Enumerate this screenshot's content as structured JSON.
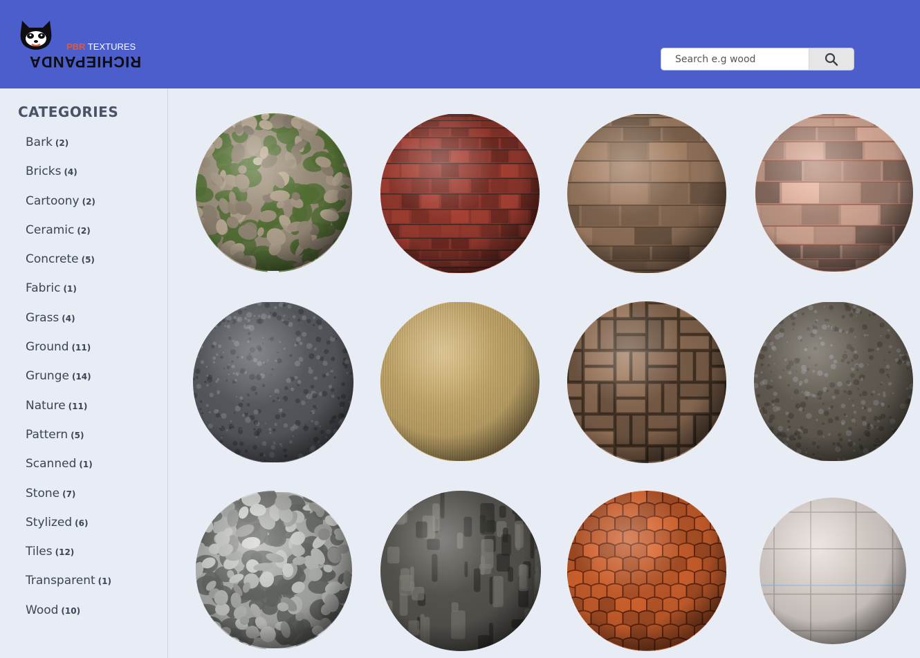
{
  "header": {
    "logo": {
      "pbr": "PBR",
      "textures": "TEXTURES",
      "brand": "RICHIEPANDA"
    },
    "search": {
      "placeholder": "Search e.g wood",
      "icon": "search-icon"
    },
    "background": "#4b5ecb"
  },
  "sidebar": {
    "title": "CATEGORIES",
    "categories": [
      {
        "label": "Bark",
        "count": "(2)"
      },
      {
        "label": "Bricks",
        "count": "(4)"
      },
      {
        "label": "Cartoony",
        "count": "(2)"
      },
      {
        "label": "Ceramic",
        "count": "(2)"
      },
      {
        "label": "Concrete",
        "count": "(5)"
      },
      {
        "label": "Fabric",
        "count": "(1)"
      },
      {
        "label": "Grass",
        "count": "(4)"
      },
      {
        "label": "Ground",
        "count": "(11)"
      },
      {
        "label": "Grunge",
        "count": "(14)"
      },
      {
        "label": "Nature",
        "count": "(11)"
      },
      {
        "label": "Pattern",
        "count": "(5)"
      },
      {
        "label": "Scanned",
        "count": "(1)"
      },
      {
        "label": "Stone",
        "count": "(7)"
      },
      {
        "label": "Stylized",
        "count": "(6)"
      },
      {
        "label": "Tiles",
        "count": "(12)"
      },
      {
        "label": "Transparent",
        "count": "(1)"
      },
      {
        "label": "Wood",
        "count": "(10)"
      }
    ]
  },
  "textures": [
    {
      "material": "mossy-cobblestone",
      "base": "#a89a86",
      "accent": "#5a7a3a",
      "pattern": "cobble"
    },
    {
      "material": "red-brick",
      "base": "#9a3b30",
      "accent": "#3a2a26",
      "pattern": "brick"
    },
    {
      "material": "wood-planks",
      "base": "#9b7a60",
      "accent": "#5a4434",
      "pattern": "planks"
    },
    {
      "material": "weathered-red-planks",
      "base": "#caa08e",
      "accent": "#a8624f",
      "pattern": "planks"
    },
    {
      "material": "dark-asphalt",
      "base": "#5d6066",
      "accent": "#2f3236",
      "pattern": "noise"
    },
    {
      "material": "knit-fabric",
      "base": "#d6b978",
      "accent": "#b39558",
      "pattern": "ribs"
    },
    {
      "material": "herringbone-wood",
      "base": "#8a6a52",
      "accent": "#4a3828",
      "pattern": "herring"
    },
    {
      "material": "forest-ground",
      "base": "#6a6358",
      "accent": "#3e3a33",
      "pattern": "noise"
    },
    {
      "material": "white-cobblestone",
      "base": "#b5b7b4",
      "accent": "#6a6c69",
      "pattern": "cobble"
    },
    {
      "material": "tree-bark",
      "base": "#5c5a55",
      "accent": "#2a2926",
      "pattern": "bark"
    },
    {
      "material": "roof-tiles",
      "base": "#c95e2c",
      "accent": "#6e2a12",
      "pattern": "roof"
    },
    {
      "material": "ceramic-tiles",
      "base": "#e6ddd8",
      "accent": "#b9b2ad",
      "pattern": "tiles"
    }
  ]
}
